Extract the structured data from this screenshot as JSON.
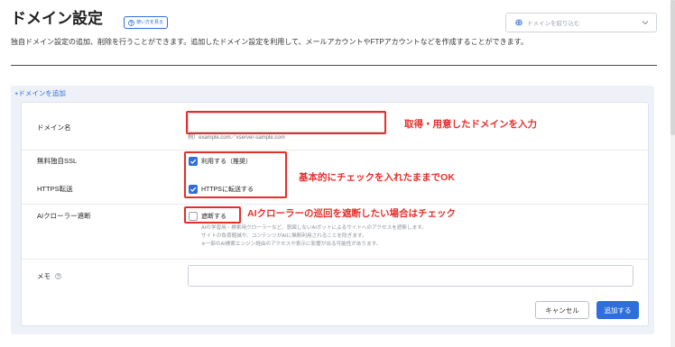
{
  "header": {
    "title": "ドメイン設定",
    "help_button_label": "使い方を見る",
    "filter_placeholder": "ドメインを絞り込む",
    "description": "独自ドメイン設定の追加、削除を行うことができます。追加したドメイン設定を利用して、メールアカウントやFTPアカウントなどを作成することができます。"
  },
  "add_link": "+ドメインを追加",
  "form": {
    "domain": {
      "label": "ドメイン名",
      "hint": "例）example.com／xserver-sample.com"
    },
    "ssl": {
      "label": "無料独自SSL",
      "option_label": "利用する（推奨）",
      "checked": true
    },
    "https": {
      "label": "HTTPS転送",
      "option_label": "HTTPSに転送する",
      "checked": true
    },
    "ai_crawler": {
      "label": "AIクローラー遮断",
      "option_label": "遮断する",
      "checked": false,
      "notes": [
        "AIの学習用・検索用クローラーなど、意図しないAIボットによるサイトへのアクセスを遮断します。",
        "サイトの負荷軽減や、コンテンツがAIに無断利用されることを防ぎます。",
        "※一部のAI検索エンジン経由のアクセスや表示に影響が出る可能性があります。"
      ]
    },
    "memo": {
      "label": "メモ"
    },
    "cancel_label": "キャンセル",
    "submit_label": "追加する"
  },
  "annotations": [
    {
      "text": "取得・用意したドメインを入力"
    },
    {
      "text": "基本的にチェックを入れたままでOK"
    },
    {
      "text": "AIクローラーの巡回を遮断したい場合はチェック"
    }
  ],
  "icons": [
    "question-circle-icon",
    "globe-icon",
    "chevron-down-icon",
    "check-icon"
  ],
  "colors": {
    "accent": "#2f6fdb",
    "annotation": "#e62e2a",
    "panel": "#eef2f8"
  }
}
